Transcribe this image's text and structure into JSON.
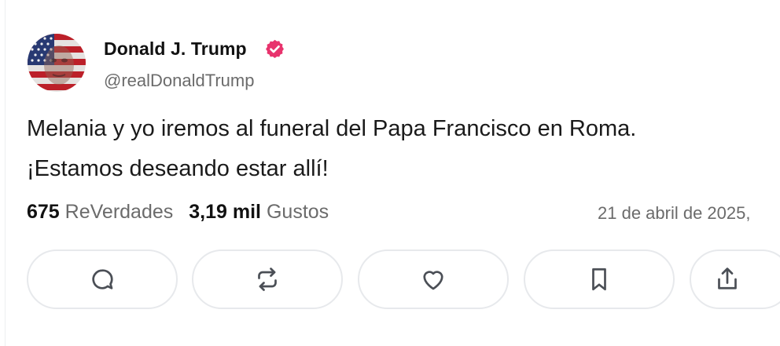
{
  "author": {
    "display_name": "Donald J. Trump",
    "handle": "@realDonaldTrump",
    "verified_icon": "verified-badge-icon",
    "avatar": "avatar-flag-face",
    "accent_color": "#e8336d"
  },
  "post": {
    "line1": "Melania y yo iremos al funeral del Papa Francisco en Roma.",
    "line2": "¡Estamos deseando estar allí!"
  },
  "stats": {
    "reposts_count": "675",
    "reposts_label": "ReVerdades",
    "likes_count": "3,19 mil",
    "likes_label": "Gustos",
    "timestamp": "21 de abril de 2025,"
  },
  "actions": [
    {
      "icon": "reply-icon"
    },
    {
      "icon": "repost-icon"
    },
    {
      "icon": "like-icon"
    },
    {
      "icon": "bookmark-icon"
    },
    {
      "icon": "share-icon"
    }
  ]
}
